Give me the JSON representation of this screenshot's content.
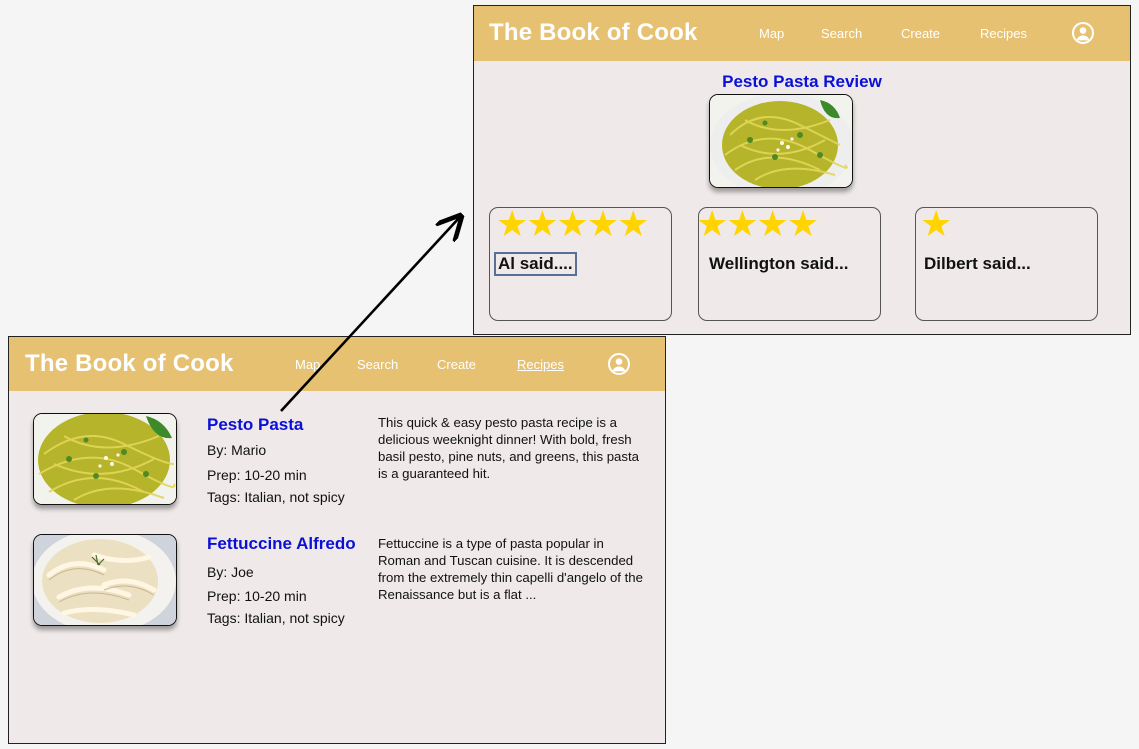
{
  "list_screen": {
    "header": {
      "brand": "The Book of Cook",
      "nav": [
        "Map",
        "Search",
        "Create",
        "Recipes"
      ],
      "active_nav": "Recipes"
    },
    "recipes": [
      {
        "title": "Pesto Pasta",
        "author": "By: Mario",
        "prep": "Prep: 10-20 min",
        "tags": "Tags: Italian, not spicy",
        "description": "This quick & easy pesto pasta recipe is a delicious weeknight dinner! With bold, fresh basil pesto, pine nuts, and greens, this pasta is a guaranteed hit."
      },
      {
        "title": "Fettuccine Alfredo",
        "author": "By: Joe",
        "prep": "Prep: 10-20 min",
        "tags": "Tags: Italian, not spicy",
        "description": "Fettuccine is a type of pasta popular in Roman and Tuscan cuisine. It is descended from the extremely thin capelli d'angelo of the Renaissance but is a flat ..."
      }
    ]
  },
  "review_screen": {
    "header": {
      "brand": "The Book of Cook",
      "nav": [
        "Map",
        "Search",
        "Create",
        "Recipes"
      ]
    },
    "title": "Pesto Pasta Review",
    "reviews": [
      {
        "author_label": "Al said....",
        "stars": 5,
        "stars_text": "★★★★★"
      },
      {
        "author_label": "Wellington said...",
        "stars": 4,
        "stars_text": "★★★★"
      },
      {
        "author_label": "Dilbert said...",
        "stars": 1,
        "stars_text": "★"
      }
    ]
  },
  "colors": {
    "header_bg": "#e6c172",
    "link_blue": "#0b10d6",
    "star_yellow": "#ffd400",
    "panel_bg": "#efe9e9"
  },
  "icons": [
    "user-avatar-icon",
    "star-icon",
    "flow-arrow"
  ]
}
